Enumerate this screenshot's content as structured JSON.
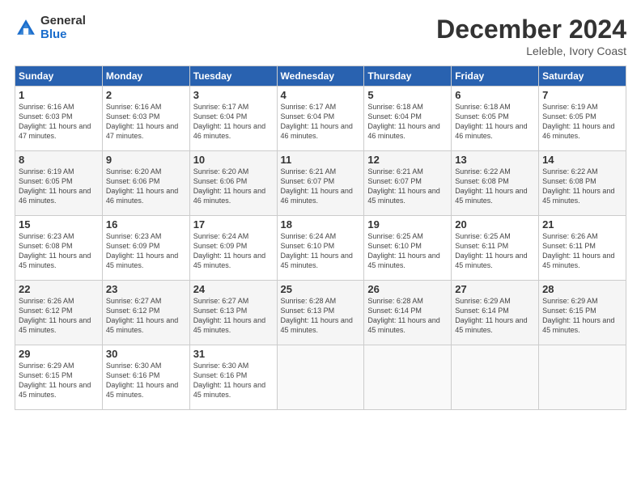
{
  "logo": {
    "general": "General",
    "blue": "Blue"
  },
  "header": {
    "title": "December 2024",
    "subtitle": "Leleble, Ivory Coast"
  },
  "calendar": {
    "days_of_week": [
      "Sunday",
      "Monday",
      "Tuesday",
      "Wednesday",
      "Thursday",
      "Friday",
      "Saturday"
    ],
    "weeks": [
      [
        null,
        {
          "day": 2,
          "sunrise": "6:16 AM",
          "sunset": "6:03 PM",
          "daylight": "11 hours and 47 minutes."
        },
        {
          "day": 3,
          "sunrise": "6:17 AM",
          "sunset": "6:04 PM",
          "daylight": "11 hours and 46 minutes."
        },
        {
          "day": 4,
          "sunrise": "6:17 AM",
          "sunset": "6:04 PM",
          "daylight": "11 hours and 46 minutes."
        },
        {
          "day": 5,
          "sunrise": "6:18 AM",
          "sunset": "6:04 PM",
          "daylight": "11 hours and 46 minutes."
        },
        {
          "day": 6,
          "sunrise": "6:18 AM",
          "sunset": "6:05 PM",
          "daylight": "11 hours and 46 minutes."
        },
        {
          "day": 7,
          "sunrise": "6:19 AM",
          "sunset": "6:05 PM",
          "daylight": "11 hours and 46 minutes."
        }
      ],
      [
        {
          "day": 1,
          "sunrise": "6:16 AM",
          "sunset": "6:03 PM",
          "daylight": "11 hours and 47 minutes."
        },
        {
          "day": 8,
          "sunrise": "6:19 AM",
          "sunset": "6:05 PM",
          "daylight": "11 hours and 46 minutes."
        },
        {
          "day": 9,
          "sunrise": "6:20 AM",
          "sunset": "6:06 PM",
          "daylight": "11 hours and 46 minutes."
        },
        {
          "day": 10,
          "sunrise": "6:20 AM",
          "sunset": "6:06 PM",
          "daylight": "11 hours and 46 minutes."
        },
        {
          "day": 11,
          "sunrise": "6:21 AM",
          "sunset": "6:07 PM",
          "daylight": "11 hours and 46 minutes."
        },
        {
          "day": 12,
          "sunrise": "6:21 AM",
          "sunset": "6:07 PM",
          "daylight": "11 hours and 45 minutes."
        },
        {
          "day": 13,
          "sunrise": "6:22 AM",
          "sunset": "6:08 PM",
          "daylight": "11 hours and 45 minutes."
        }
      ],
      [
        {
          "day": 14,
          "sunrise": "6:22 AM",
          "sunset": "6:08 PM",
          "daylight": "11 hours and 45 minutes."
        },
        {
          "day": 15,
          "sunrise": "6:23 AM",
          "sunset": "6:08 PM",
          "daylight": "11 hours and 45 minutes."
        },
        {
          "day": 16,
          "sunrise": "6:23 AM",
          "sunset": "6:09 PM",
          "daylight": "11 hours and 45 minutes."
        },
        {
          "day": 17,
          "sunrise": "6:24 AM",
          "sunset": "6:09 PM",
          "daylight": "11 hours and 45 minutes."
        },
        {
          "day": 18,
          "sunrise": "6:24 AM",
          "sunset": "6:10 PM",
          "daylight": "11 hours and 45 minutes."
        },
        {
          "day": 19,
          "sunrise": "6:25 AM",
          "sunset": "6:10 PM",
          "daylight": "11 hours and 45 minutes."
        },
        {
          "day": 20,
          "sunrise": "6:25 AM",
          "sunset": "6:11 PM",
          "daylight": "11 hours and 45 minutes."
        }
      ],
      [
        {
          "day": 21,
          "sunrise": "6:26 AM",
          "sunset": "6:11 PM",
          "daylight": "11 hours and 45 minutes."
        },
        {
          "day": 22,
          "sunrise": "6:26 AM",
          "sunset": "6:12 PM",
          "daylight": "11 hours and 45 minutes."
        },
        {
          "day": 23,
          "sunrise": "6:27 AM",
          "sunset": "6:12 PM",
          "daylight": "11 hours and 45 minutes."
        },
        {
          "day": 24,
          "sunrise": "6:27 AM",
          "sunset": "6:13 PM",
          "daylight": "11 hours and 45 minutes."
        },
        {
          "day": 25,
          "sunrise": "6:28 AM",
          "sunset": "6:13 PM",
          "daylight": "11 hours and 45 minutes."
        },
        {
          "day": 26,
          "sunrise": "6:28 AM",
          "sunset": "6:14 PM",
          "daylight": "11 hours and 45 minutes."
        },
        {
          "day": 27,
          "sunrise": "6:29 AM",
          "sunset": "6:14 PM",
          "daylight": "11 hours and 45 minutes."
        }
      ],
      [
        {
          "day": 28,
          "sunrise": "6:29 AM",
          "sunset": "6:15 PM",
          "daylight": "11 hours and 45 minutes."
        },
        {
          "day": 29,
          "sunrise": "6:29 AM",
          "sunset": "6:15 PM",
          "daylight": "11 hours and 45 minutes."
        },
        {
          "day": 30,
          "sunrise": "6:30 AM",
          "sunset": "6:16 PM",
          "daylight": "11 hours and 45 minutes."
        },
        {
          "day": 31,
          "sunrise": "6:30 AM",
          "sunset": "6:16 PM",
          "daylight": "11 hours and 45 minutes."
        },
        null,
        null,
        null
      ]
    ]
  }
}
